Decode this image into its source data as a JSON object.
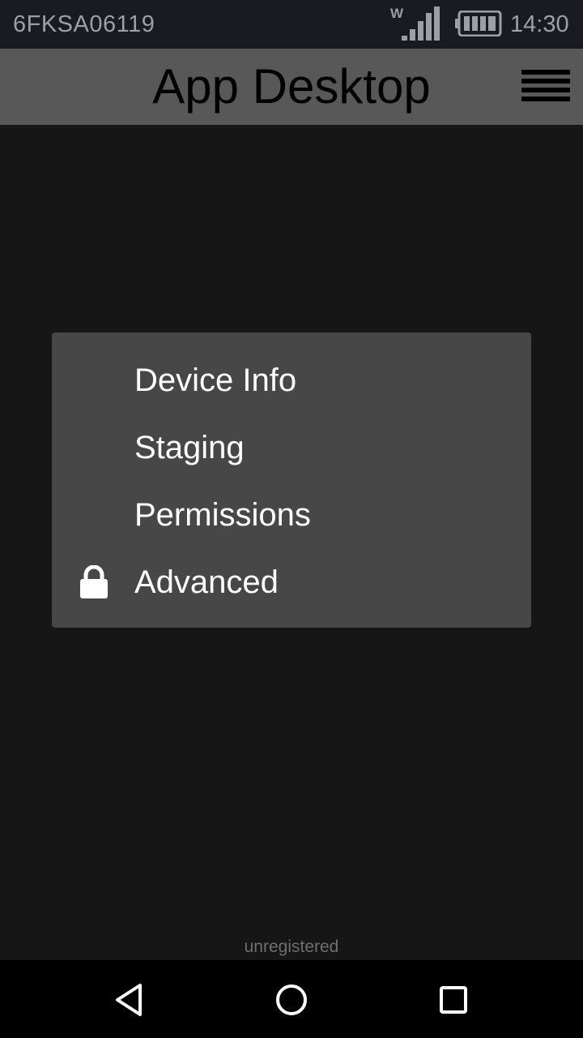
{
  "status_bar": {
    "device_id": "6FKSA06119",
    "network_label": "W",
    "time": "14:30"
  },
  "app_bar": {
    "title": "App Desktop",
    "menu_icon": "hamburger-menu-icon"
  },
  "popup_menu": {
    "items": [
      {
        "label": "Device Info",
        "icon": null
      },
      {
        "label": "Staging",
        "icon": null
      },
      {
        "label": "Permissions",
        "icon": null
      },
      {
        "label": "Advanced",
        "icon": "lock-icon"
      }
    ]
  },
  "footer": {
    "status_text": "unregistered"
  },
  "nav_bar": {
    "buttons": [
      "back-triangle-icon",
      "home-circle-icon",
      "recents-square-icon"
    ]
  },
  "colors": {
    "status_bar_bg": "#181b21",
    "app_bar_bg": "#585858",
    "background": "#161616",
    "popup_bg": "#474747",
    "popup_text": "#ffffff"
  }
}
